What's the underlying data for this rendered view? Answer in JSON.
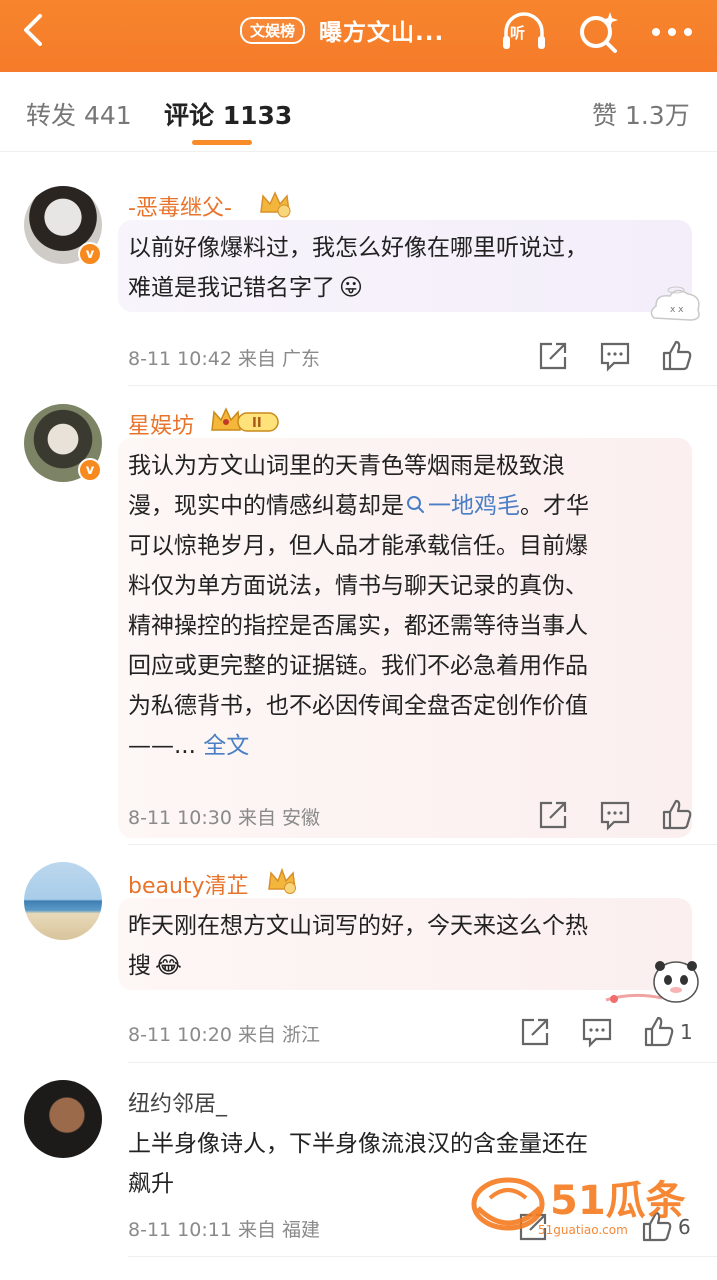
{
  "header": {
    "badge": "文娱榜",
    "title": "曝方文山...",
    "listen_label": "听",
    "accent": "#f67b2a"
  },
  "tabs": [
    {
      "label": "转发 441"
    },
    {
      "label": "评论 1133"
    },
    {
      "label": "赞 1.3万"
    }
  ],
  "comments": [
    {
      "username": "-恶毒继父-",
      "text_lines": [
        "以前好像爆料过，我怎么好像在哪里听说过，",
        "难道是我记错名字了"
      ],
      "emoji": "😛",
      "time": "8-11 10:42",
      "location": "来自 广东",
      "likes": ""
    },
    {
      "username": "星娱坊",
      "rank_badge": "II",
      "text_lines": [
        "我认为方文山词里的天青色等烟雨是极致浪",
        "漫，现实中的情感纠葛却是",
        "可以惊艳岁月，但人品才能承载信任。目前爆",
        "料仅为单方面说法，情书与聊天记录的真伪、",
        "精神操控的指控是否属实，都还需等待当事人",
        "回应或更完整的证据链。我们不必急着用作品",
        "为私德背书，也不必因传闻全盘否定创作价值",
        "——..."
      ],
      "search_link": "一地鸡毛",
      "after_link": "。才华",
      "full_text": "全文",
      "time": "8-11 10:30",
      "location": "来自 安徽",
      "likes": ""
    },
    {
      "username": "beauty清芷",
      "text_lines": [
        "昨天刚在想方文山词写的好，今天来这么个热",
        "搜"
      ],
      "emoji": "😂",
      "time": "8-11 10:20",
      "location": "来自 浙江",
      "likes": "1"
    },
    {
      "username": "纽约邻居_",
      "text_lines": [
        "上半身像诗人，下半身像流浪汉的含金量还在",
        "飙升"
      ],
      "time": "8-11 10:11",
      "location": "来自 福建",
      "likes": "6"
    }
  ],
  "watermark": {
    "brand": "51瓜条",
    "url": "51guatiao.com"
  }
}
